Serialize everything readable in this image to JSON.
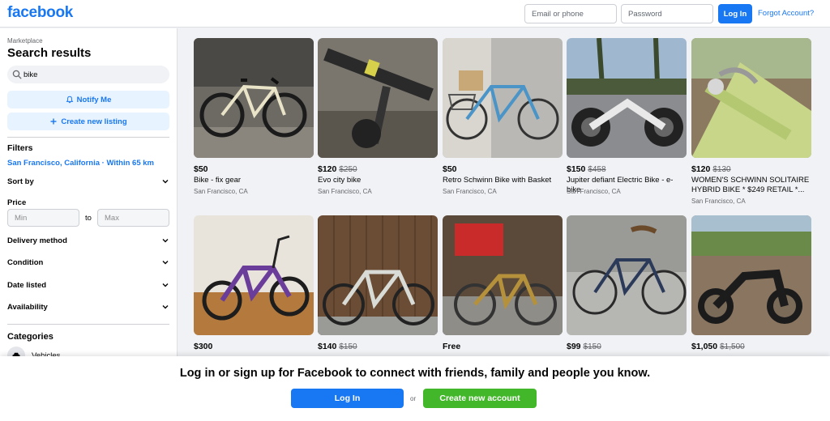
{
  "header": {
    "logo": "facebook",
    "email_placeholder": "Email or phone",
    "password_placeholder": "Password",
    "login_label": "Log In",
    "forgot_label": "Forgot Account?"
  },
  "sidebar": {
    "section": "Marketplace",
    "title": "Search results",
    "search_value": "bike",
    "notify_label": "Notify Me",
    "create_label": "Create new listing",
    "filters_title": "Filters",
    "location": "San Francisco, California · Within 65 km",
    "sort_by": "Sort by",
    "price_label": "Price",
    "min_placeholder": "Min",
    "to_label": "to",
    "max_placeholder": "Max",
    "delivery": "Delivery method",
    "condition": "Condition",
    "date_listed": "Date listed",
    "availability": "Availability",
    "categories_title": "Categories",
    "category_1": "Vehicles"
  },
  "listings": [
    {
      "price": "$50",
      "old_price": "",
      "title": "Bike - fix gear",
      "location": "San Francisco, CA"
    },
    {
      "price": "$120",
      "old_price": "$250",
      "title": "Evo city bike",
      "location": "San Francisco, CA"
    },
    {
      "price": "$50",
      "old_price": "",
      "title": "Retro Schwinn Bike with Basket",
      "location": "San Francisco, CA"
    },
    {
      "price": "$150",
      "old_price": "$458",
      "title": "Jupiter defiant Electric Bike - e-bike",
      "location": "San Francisco, CA"
    },
    {
      "price": "$120",
      "old_price": "$130",
      "title": "WOMEN'S SCHWINN SOLITAIRE HYBRID BIKE * $249 RETAIL *...",
      "location": "San Francisco, CA"
    },
    {
      "price": "$300",
      "old_price": "",
      "title": "",
      "location": ""
    },
    {
      "price": "$140",
      "old_price": "$150",
      "title": "",
      "location": ""
    },
    {
      "price": "Free",
      "old_price": "",
      "title": "",
      "location": ""
    },
    {
      "price": "$99",
      "old_price": "$150",
      "title": "",
      "location": ""
    },
    {
      "price": "$1,050",
      "old_price": "$1,500",
      "title": "",
      "location": ""
    }
  ],
  "bottom": {
    "message": "Log in or sign up for Facebook to connect with friends, family and people you know.",
    "login_label": "Log In",
    "or_label": "or",
    "create_label": "Create new account"
  },
  "colors": {
    "brand": "#1877f2",
    "create_green": "#42b72a",
    "background": "#f0f2f5"
  }
}
